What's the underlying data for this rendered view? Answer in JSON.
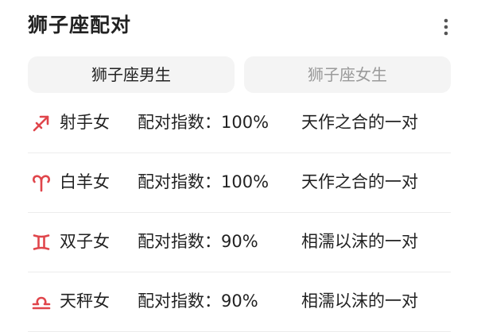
{
  "app": {
    "title": "狮子座配对"
  },
  "header": {
    "more_icon": "more-vertical-icon"
  },
  "tabs": [
    {
      "label": "狮子座男生",
      "active": true
    },
    {
      "label": "狮子座女生",
      "active": false
    }
  ],
  "matches": [
    {
      "icon": "sagittarius-icon",
      "sign": "射手女",
      "score_text": "配对指数：100%",
      "score": 100,
      "description": "天作之合的一对"
    },
    {
      "icon": "aries-icon",
      "sign": "白羊女",
      "score_text": "配对指数：100%",
      "score": 100,
      "description": "天作之合的一对"
    },
    {
      "icon": "gemini-icon",
      "sign": "双子女",
      "score_text": "配对指数：90%",
      "score": 90,
      "description": "相濡以沫的一对"
    },
    {
      "icon": "libra-icon",
      "sign": "天秤女",
      "score_text": "配对指数：90%",
      "score": 90,
      "description": "相濡以沫的一对"
    }
  ],
  "colors": {
    "icon_accent": "#e0454b",
    "tab_background": "#f4f4f4",
    "inactive_tab_text": "#9a9a9a",
    "divider": "#ececec"
  }
}
